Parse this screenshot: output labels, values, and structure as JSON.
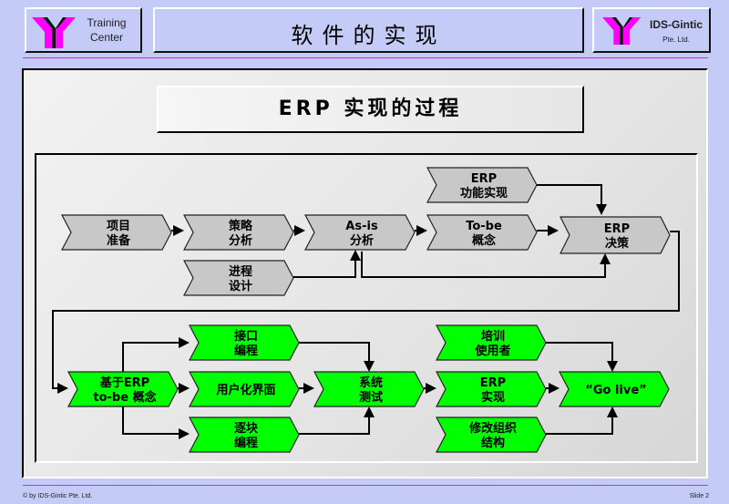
{
  "header": {
    "left_logo": {
      "line1": "Training",
      "line2": "Center",
      "color": "#ff00ff"
    },
    "title": "软件的实现",
    "right_logo": {
      "line1": "IDS-Gintic",
      "line2": "Pte. Ltd.",
      "color": "#ff00ff"
    }
  },
  "subtitle": "ERP 实现的过程",
  "colors": {
    "gray_node": "#c8c8c8",
    "green_node": "#00ff00",
    "accent_rule": "#d12ec8",
    "background": "#c3cbf6"
  },
  "diagram": {
    "nodes": [
      {
        "id": "project-prep",
        "lines": [
          "项目",
          "准备"
        ],
        "color": "gray"
      },
      {
        "id": "strategy-analysis",
        "lines": [
          "策略",
          "分析"
        ],
        "color": "gray"
      },
      {
        "id": "asis-analysis",
        "lines": [
          "As-is",
          "分析"
        ],
        "color": "gray"
      },
      {
        "id": "tobe-concept",
        "lines": [
          "To-be",
          "概念"
        ],
        "color": "gray"
      },
      {
        "id": "erp-decision",
        "lines": [
          "ERP",
          "决策"
        ],
        "color": "gray"
      },
      {
        "id": "erp-function",
        "lines": [
          "ERP",
          "功能实现"
        ],
        "color": "gray"
      },
      {
        "id": "process-design",
        "lines": [
          "进程",
          "设计"
        ],
        "color": "gray"
      },
      {
        "id": "erp-tobe-concept",
        "lines": [
          "基于ERP",
          "to-be 概念"
        ],
        "color": "green"
      },
      {
        "id": "interface-coding",
        "lines": [
          "接口",
          "编程"
        ],
        "color": "green"
      },
      {
        "id": "user-interface",
        "lines": [
          "用户化界面"
        ],
        "color": "green"
      },
      {
        "id": "module-coding",
        "lines": [
          "逐块",
          "编程"
        ],
        "color": "green"
      },
      {
        "id": "system-test",
        "lines": [
          "系统",
          "测试"
        ],
        "color": "green"
      },
      {
        "id": "train-users",
        "lines": [
          "培训",
          "使用者"
        ],
        "color": "green"
      },
      {
        "id": "erp-implement",
        "lines": [
          "ERP",
          "实现"
        ],
        "color": "green"
      },
      {
        "id": "modify-org",
        "lines": [
          "修改组织",
          "结构"
        ],
        "color": "green"
      },
      {
        "id": "go-live",
        "lines": [
          "“Go live”"
        ],
        "color": "green"
      }
    ],
    "edges": [
      [
        "project-prep",
        "strategy-analysis"
      ],
      [
        "strategy-analysis",
        "asis-analysis"
      ],
      [
        "process-design",
        "asis-analysis"
      ],
      [
        "asis-analysis",
        "tobe-concept"
      ],
      [
        "asis-analysis",
        "erp-decision"
      ],
      [
        "tobe-concept",
        "erp-decision"
      ],
      [
        "erp-function",
        "erp-decision"
      ],
      [
        "erp-decision",
        "erp-tobe-concept"
      ],
      [
        "erp-tobe-concept",
        "interface-coding"
      ],
      [
        "erp-tobe-concept",
        "user-interface"
      ],
      [
        "erp-tobe-concept",
        "module-coding"
      ],
      [
        "interface-coding",
        "system-test"
      ],
      [
        "user-interface",
        "system-test"
      ],
      [
        "module-coding",
        "system-test"
      ],
      [
        "system-test",
        "erp-implement"
      ],
      [
        "erp-implement",
        "go-live"
      ],
      [
        "train-users",
        "go-live"
      ],
      [
        "modify-org",
        "go-live"
      ]
    ]
  },
  "footer": {
    "copyright": "© by IDS-Gintic Pte. Ltd.",
    "slide": "Slide 2"
  }
}
